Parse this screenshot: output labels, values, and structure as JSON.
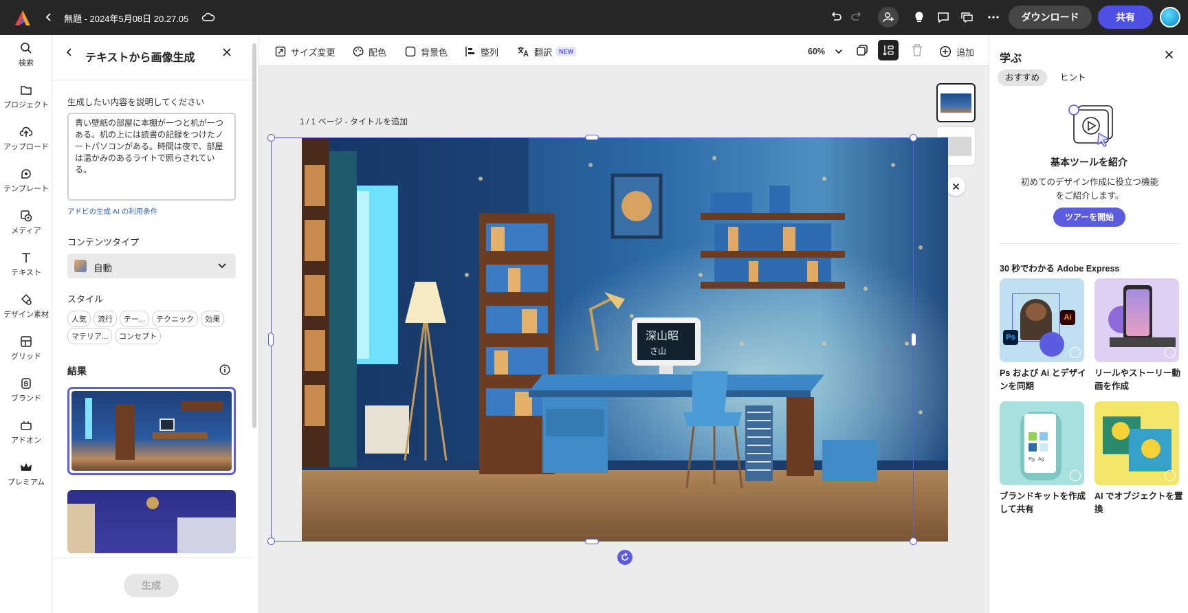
{
  "topbar": {
    "doc_title": "無題 - 2024年5月08日 20.27.05",
    "download_label": "ダウンロード",
    "share_label": "共有"
  },
  "rail": [
    {
      "label": "検索",
      "icon": "search-icon"
    },
    {
      "label": "プロジェクト",
      "icon": "folder-icon"
    },
    {
      "label": "アップロード",
      "icon": "upload-cloud-icon"
    },
    {
      "label": "テンプレート",
      "icon": "templates-icon"
    },
    {
      "label": "メディア",
      "icon": "media-icon"
    },
    {
      "label": "テキスト",
      "icon": "text-icon"
    },
    {
      "label": "デザイン素材",
      "icon": "design-elements-icon"
    },
    {
      "label": "グリッド",
      "icon": "grid-icon"
    },
    {
      "label": "ブランド",
      "icon": "brand-icon"
    },
    {
      "label": "アドオン",
      "icon": "addons-icon"
    },
    {
      "label": "プレミアム",
      "icon": "premium-crown-icon"
    }
  ],
  "panel": {
    "title": "テキストから画像生成",
    "prompt_label": "生成したい内容を説明してください",
    "prompt_value": "青い壁紙の部屋に本棚が一つと机が一つある。机の上には読書の記録をつけたノートパソコンがある。時間は夜で、部屋は温かみのあるライトで照らされている。",
    "terms_link": "アドビの生成 AI の利用条件",
    "content_type_label": "コンテンツタイプ",
    "content_type_value": "自動",
    "style_label": "スタイル",
    "style_chips_row1": [
      "人気",
      "流行",
      "テー...",
      "テクニック",
      "効果"
    ],
    "style_chips_row2": [
      "マテリア...",
      "コンセプト"
    ],
    "results_label": "結果",
    "generate_button": "生成"
  },
  "toolbar": {
    "resize": "サイズ変更",
    "color": "配色",
    "background": "背景色",
    "align": "整列",
    "translate": "翻訳",
    "translate_badge": "NEW",
    "zoom": "60%",
    "add": "追加"
  },
  "canvas": {
    "page_label": "1 / 1 ページ - タイトルを追加",
    "monitor_text": "深山昭\nさ山"
  },
  "learn": {
    "title": "学ぶ",
    "tabs": [
      "おすすめ",
      "ヒント"
    ],
    "intro_title": "基本ツールを紹介",
    "intro_desc": "初めてのデザイン作成に役立つ機能をご紹介します。",
    "tour_button": "ツアーを開始",
    "section_title": "30 秒でわかる Adobe Express",
    "cards": [
      {
        "label": "Ps および Ai とデザインを同期"
      },
      {
        "label": "リールやストーリー動画を作成"
      },
      {
        "label": "ブランドキットを作成して共有"
      },
      {
        "label": "AI でオブジェクトを置換"
      }
    ],
    "card1_badges": [
      "Ps",
      "Ai"
    ],
    "card3_tags": [
      "Rg",
      "Ag"
    ]
  },
  "colors": {
    "accent": "#5c5ce0",
    "topbar": "#272727",
    "share_button": "#4f4fe5"
  }
}
